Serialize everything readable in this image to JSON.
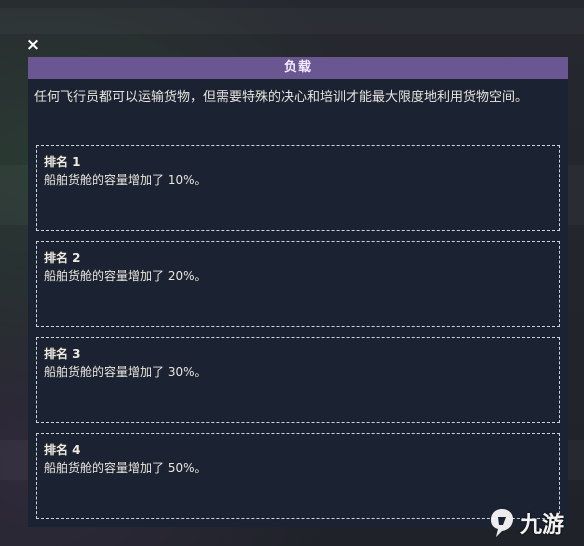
{
  "window": {
    "close_glyph": "×"
  },
  "panel": {
    "title": "负载",
    "description": "任何飞行员都可以运输货物，但需要特殊的决心和培训才能最大限度地利用货物空间。",
    "ranks": [
      {
        "title": "排名 1",
        "desc": "船舶货舱的容量增加了 10%。"
      },
      {
        "title": "排名 2",
        "desc": "船舶货舱的容量增加了 20%。"
      },
      {
        "title": "排名 3",
        "desc": "船舶货舱的容量增加了 30%。"
      },
      {
        "title": "排名 4",
        "desc": "船舶货舱的容量增加了 50%。"
      }
    ]
  },
  "watermark": {
    "text": "九游",
    "icon": "jiuyou-logo-icon"
  },
  "colors": {
    "header": "#6a5690",
    "panel_bg": "#1b2231",
    "border": "#cfd3da"
  }
}
